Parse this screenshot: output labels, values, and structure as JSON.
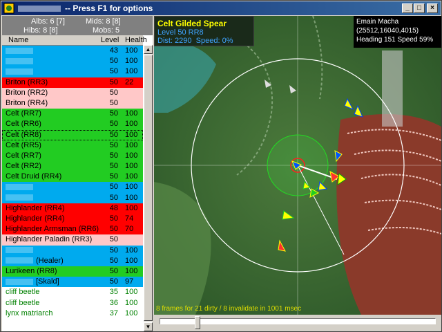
{
  "window": {
    "title": "-- Press F1 for options",
    "controls": {
      "minimize": "_",
      "maximize": "□",
      "close": "×"
    }
  },
  "stats": {
    "albs": "Albs: 6 [7]",
    "mids": "Mids: 8 [8]",
    "hibs": "Hibs: 8 [8]",
    "mobs": "Mobs: 5"
  },
  "columns": {
    "name": "Name",
    "level": "Level",
    "health": "Health"
  },
  "rows": [
    {
      "name": "",
      "level": "43",
      "health": "100",
      "color": "blue",
      "blurred": true
    },
    {
      "name": "",
      "level": "50",
      "health": "100",
      "color": "blue",
      "blurred": true
    },
    {
      "name": "",
      "level": "50",
      "health": "100",
      "color": "blue",
      "blurred": true
    },
    {
      "name": "Briton (RR3)",
      "level": "50",
      "health": "22",
      "color": "red"
    },
    {
      "name": "Briton (RR2)",
      "level": "50",
      "health": "",
      "color": "pink"
    },
    {
      "name": "Briton (RR4)",
      "level": "50",
      "health": "",
      "color": "pink"
    },
    {
      "name": "Celt (RR7)",
      "level": "50",
      "health": "100",
      "color": "green"
    },
    {
      "name": "Celt (RR6)",
      "level": "50",
      "health": "100",
      "color": "green"
    },
    {
      "name": "Celt (RR8)",
      "level": "50",
      "health": "100",
      "color": "green",
      "selected": true
    },
    {
      "name": "Celt (RR5)",
      "level": "50",
      "health": "100",
      "color": "green"
    },
    {
      "name": "Celt (RR7)",
      "level": "50",
      "health": "100",
      "color": "green"
    },
    {
      "name": "Celt (RR2)",
      "level": "50",
      "health": "100",
      "color": "green"
    },
    {
      "name": "Celt Druid (RR4)",
      "level": "50",
      "health": "100",
      "color": "green"
    },
    {
      "name": "",
      "level": "50",
      "health": "100",
      "color": "blue",
      "blurred": true
    },
    {
      "name": "",
      "level": "50",
      "health": "100",
      "color": "blue",
      "blurred": true
    },
    {
      "name": "Highlander (RR4)",
      "level": "48",
      "health": "100",
      "color": "red"
    },
    {
      "name": "Highlander (RR4)",
      "level": "50",
      "health": "74",
      "color": "red"
    },
    {
      "name": "Highlander Armsman (RR6)",
      "level": "50",
      "health": "70",
      "color": "red"
    },
    {
      "name": "Highlander Paladin (RR3)",
      "level": "50",
      "health": "",
      "color": "pink"
    },
    {
      "name": "",
      "level": "50",
      "health": "100",
      "color": "blue",
      "blurred": true
    },
    {
      "name": "",
      "extra": "(Healer)",
      "level": "50",
      "health": "100",
      "color": "blue",
      "blurred": true
    },
    {
      "name": "Lurikeen (RR8)",
      "level": "50",
      "health": "100",
      "color": "green"
    },
    {
      "name": "",
      "extra": "[Skald]",
      "level": "50",
      "health": "97",
      "color": "blue",
      "blurred": true
    },
    {
      "name": "cliff beetle",
      "level": "35",
      "health": "100",
      "color": "white"
    },
    {
      "name": "cliff beetle",
      "level": "36",
      "health": "100",
      "color": "white"
    },
    {
      "name": "lynx matriarch",
      "level": "37",
      "health": "100",
      "color": "white"
    }
  ],
  "target": {
    "name": "Celt Gilded Spear",
    "level": "Level 50 RR8",
    "dist": "Dist: 2290",
    "speed": "Speed: 0%"
  },
  "zone": {
    "name": "Emain Macha",
    "coords": "(25512,16040,4015)",
    "heading": "Heading 151 Speed 59%"
  },
  "status": {
    "fps": "8 frames for 21 dirty / 8 invalidate in 1001 msec"
  },
  "slider": {
    "position": 0.13
  },
  "colors": {
    "blue": "#00aaee",
    "red": "#ff0000",
    "pink": "#ffc8c8",
    "green": "#22cc22",
    "white": "#ffffff",
    "titlebar": "#0a246a"
  }
}
